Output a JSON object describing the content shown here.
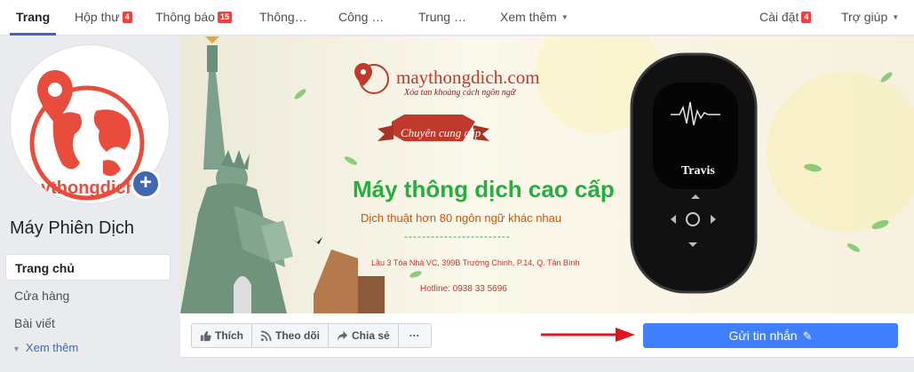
{
  "tabs": [
    {
      "label": "Trang",
      "badge": ""
    },
    {
      "label": "Hộp thư",
      "badge": "4"
    },
    {
      "label": "Thông báo",
      "badge": "15"
    },
    {
      "label": "Thông…",
      "badge": ""
    },
    {
      "label": "Công …",
      "badge": ""
    },
    {
      "label": "Trung …",
      "badge": ""
    },
    {
      "label": "Xem thêm",
      "badge": ""
    }
  ],
  "right_tabs": {
    "settings": {
      "label": "Cài đặt",
      "badge": "4"
    },
    "help": {
      "label": "Trợ giúp"
    }
  },
  "profile": {
    "avatar_text": "ythongdich",
    "plus": "+",
    "page_name": "Máy Phiên Dịch"
  },
  "nav": [
    {
      "label": "Trang chủ"
    },
    {
      "label": "Cửa hàng"
    },
    {
      "label": "Bài viết"
    }
  ],
  "see_more": "Xem thêm",
  "cover": {
    "domain": "maythongdich.com",
    "slogan": "Xóa tan khoảng cách ngôn ngữ",
    "badge": "Chuyên cung cấp",
    "headline": "Máy thông dịch cao cấp",
    "sub": "Dịch thuật hơn 80 ngôn ngữ khác nhau",
    "dash": "------------------------",
    "address": "Lầu 3 Tòa Nhà VC, 399B Trường Chinh, P.14, Q. Tân Bình",
    "hotline": "Hotline: 0938 33 5696",
    "device_brand": "Travis"
  },
  "actions": {
    "like": "Thích",
    "follow": "Theo dõi",
    "share": "Chia sẻ",
    "more": "···",
    "send_message": "Gửi tin nhắn"
  },
  "colors": {
    "accent": "#4267b2",
    "send_button": "#4080ff",
    "badge": "#fa3e3e",
    "headline_green": "#27ae3e",
    "brand_red": "#c0392b",
    "arrow_red": "#e0141e"
  }
}
